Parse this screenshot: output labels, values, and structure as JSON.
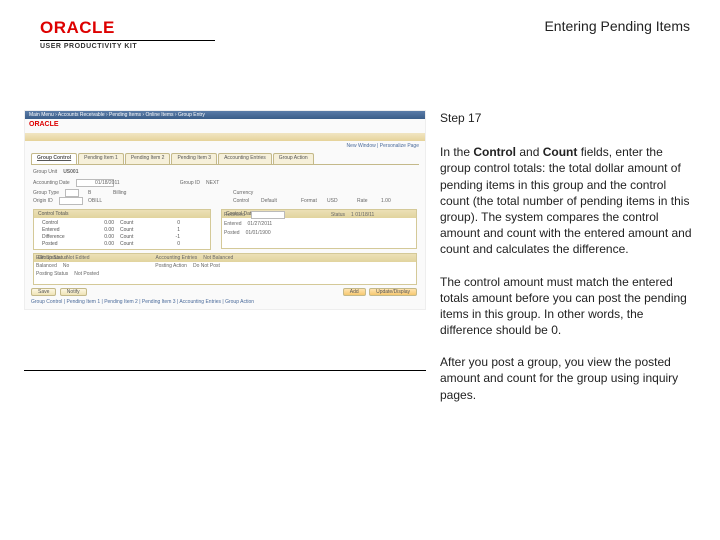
{
  "header": {
    "brand": "ORACLE",
    "subbrand": "USER PRODUCTIVITY KIT",
    "page_title": "Entering Pending Items"
  },
  "instruction": {
    "step_label": "Step 17",
    "para1_a": "In the ",
    "para1_b": "Control",
    "para1_c": " and ",
    "para1_d": "Count",
    "para1_e": " fields, enter the group control totals: the total dollar amount of pending items in this group and the control count (the total number of pending items in this group). The system compares the control amount and count with the entered amount and count and calculates the difference.",
    "para2": "The control amount must match the entered totals amount before you can post the pending items in this group. In other words, the difference should be 0.",
    "para3": "After you post a group, you view the posted amount and count for the group using inquiry pages."
  },
  "screenshot": {
    "topbar": "Main Menu  ›  Accounts Receivable  ›  Pending Items  ›  Online Items  ›  Group Entry",
    "brand": "ORACLE",
    "link_right": "New Window | Personalize Page",
    "tabs": [
      "Group Control",
      "Pending Item 1",
      "Pending Item 2",
      "Pending Item 3",
      "Accounting Entries",
      "Group Action"
    ],
    "row1": {
      "label": "Group Unit",
      "val": "US001"
    },
    "row2": {
      "label": "Accounting Date",
      "val": "01/18/2011",
      "bal_lab": "Group ID",
      "bal_val": "NEXT"
    },
    "row3": {
      "l1": "Group Type",
      "v1": "B",
      "l2": "Billing"
    },
    "row4": {
      "l1": "Origin ID",
      "v1": "OBILL"
    },
    "currency_lab": "Currency",
    "row5": {
      "l1": "Control",
      "v1": "Default",
      "l2": "Format",
      "v2": "USD",
      "l3": "Rate",
      "v3": "1.00"
    },
    "ctl_title": "Control Totals",
    "ctl_grid": {
      "r1": [
        "Control",
        "0.00",
        "Count",
        "0"
      ],
      "r2": [
        "Entered",
        "0.00",
        "Count",
        "1"
      ],
      "r3": [
        "Difference",
        "0.00",
        "Count",
        "-1"
      ],
      "r4": [
        "Posted",
        "0.00",
        "Count",
        "0"
      ]
    },
    "cd_title": "Control Data",
    "cd": {
      "r1": [
        "Received",
        "01/27/2011",
        "Status",
        "1 01/18/11"
      ],
      "r2": [
        "Entered",
        "01/27/2011"
      ],
      "r3": [
        "Posted",
        "01/01/1900"
      ]
    },
    "gs_title": "Group Status",
    "gs": {
      "l1": "Edit Status",
      "v1": "Not Edited",
      "l2": "Accounting Entries",
      "v2": "Not Balanced",
      "l3": "Balanced",
      "v3": "No",
      "l4": "Posting Action",
      "v4": "Do Not Post",
      "l5": "Posting Status",
      "v5": "Not Posted"
    },
    "footer": {
      "save": "Save",
      "notify": "Notify",
      "add": "Add",
      "update": "Update/Display",
      "breadcrumb": "Group Control | Pending Item 1 | Pending Item 2 | Pending Item 3 | Accounting Entries | Group Action"
    }
  }
}
